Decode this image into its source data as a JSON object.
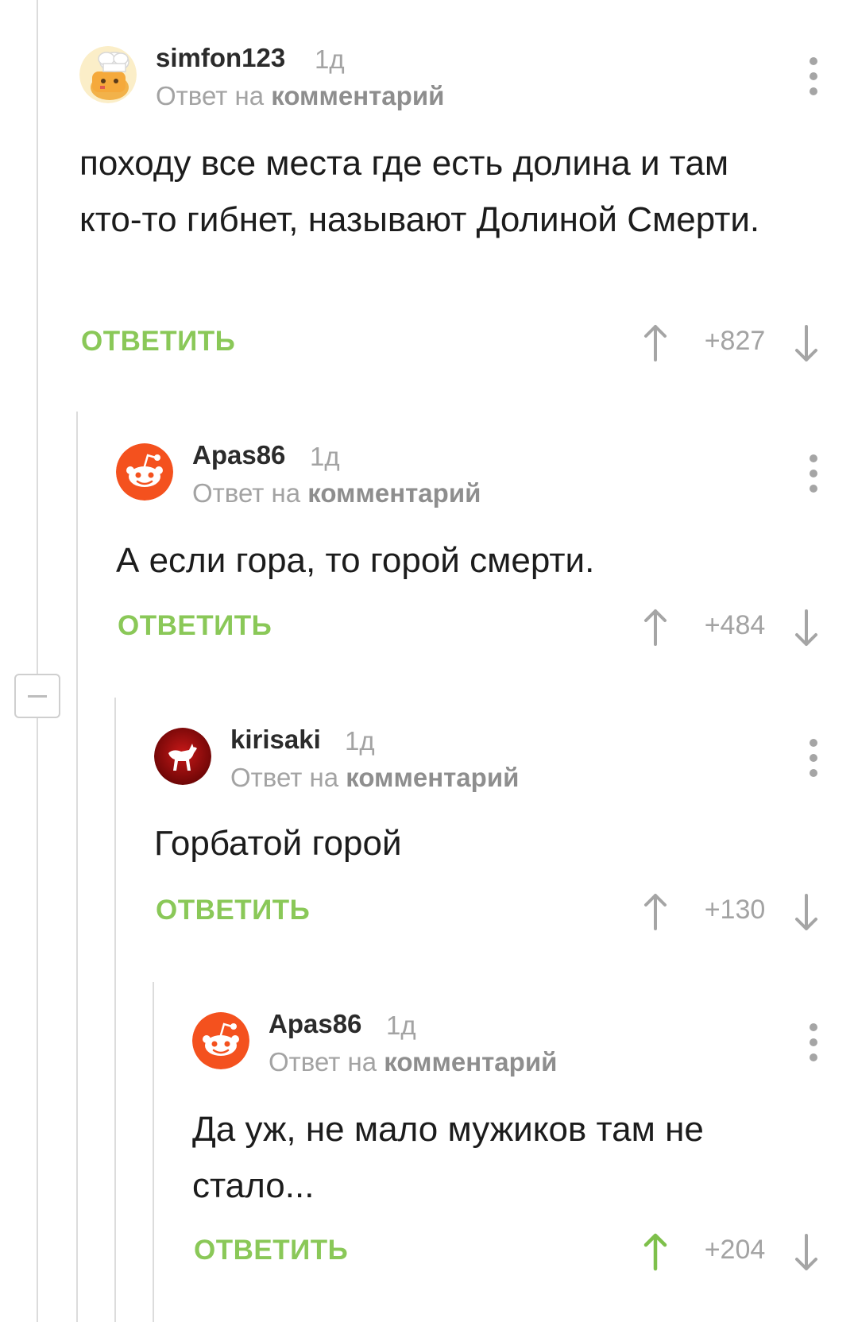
{
  "colors": {
    "accent_green": "#8ac858",
    "muted_text": "#a3a3a3",
    "thread_line": "#dcdcdc",
    "vote_arrow": "#a5a5a5",
    "vote_arrow_active": "#7ec04b"
  },
  "collapse_button": {
    "icon": "minus-icon"
  },
  "comments": [
    {
      "author": "simfon123",
      "time": "1д",
      "reply_prefix": "Ответ на",
      "reply_target": "комментарий",
      "text": "походу все места где есть долина и там кто-то гибнет, называют Долиной Смерти.",
      "reply_label": "ОТВЕТИТЬ",
      "score": "+827",
      "avatar_icon": "chef-cat-avatar",
      "upvoted": false
    },
    {
      "author": "Apas86",
      "time": "1д",
      "reply_prefix": "Ответ на",
      "reply_target": "комментарий",
      "text": "А если гора, то горой смерти.",
      "reply_label": "ОТВЕТИТЬ",
      "score": "+484",
      "avatar_icon": "reddit-alien-avatar",
      "upvoted": false
    },
    {
      "author": "kirisaki",
      "time": "1д",
      "reply_prefix": "Ответ на",
      "reply_target": "комментарий",
      "text": "Горбатой горой",
      "reply_label": "ОТВЕТИТЬ",
      "score": "+130",
      "avatar_icon": "white-pony-avatar",
      "upvoted": false
    },
    {
      "author": "Apas86",
      "time": "1д",
      "reply_prefix": "Ответ на",
      "reply_target": "комментарий",
      "text": "Да уж, не мало мужиков там не стало...",
      "reply_label": "ОТВЕТИТЬ",
      "score": "+204",
      "avatar_icon": "reddit-alien-avatar",
      "upvoted": true
    }
  ]
}
